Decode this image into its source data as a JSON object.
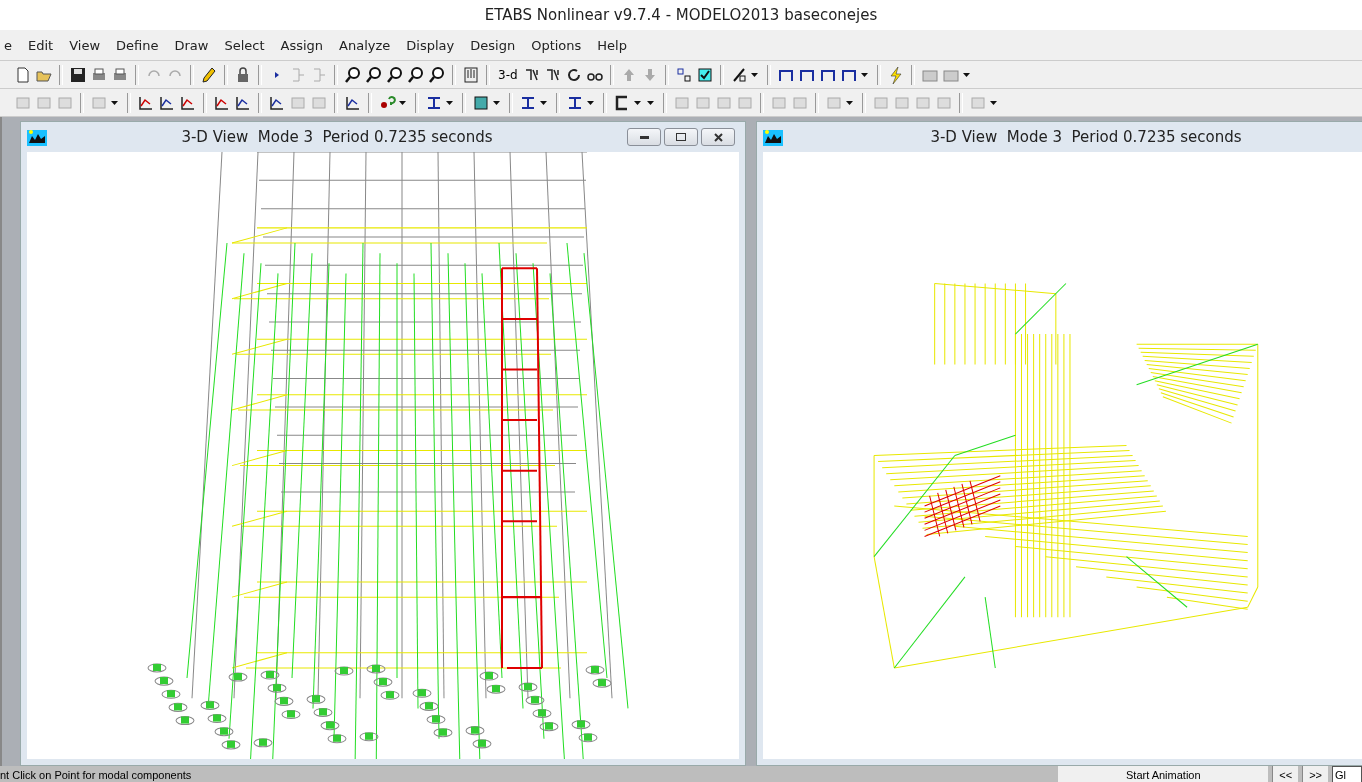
{
  "window": {
    "title": "ETABS Nonlinear v9.7.4 - MODELO2013 baseconejes"
  },
  "menu": [
    "e",
    "Edit",
    "View",
    "Define",
    "Draw",
    "Select",
    "Assign",
    "Analyze",
    "Display",
    "Design",
    "Options",
    "Help"
  ],
  "toolbar": {
    "view_3d_label": "3-d"
  },
  "views": [
    {
      "title": "3-D View  Mode 3  Period 0.7235 seconds",
      "kind": "tower",
      "controls": true
    },
    {
      "title": "3-D View  Mode 3  Period 0.7235 seconds",
      "kind": "plan",
      "controls": false
    }
  ],
  "status_bar": {
    "message": "nt Click on Point for modal components",
    "animation_button": "Start Animation",
    "prev_button": "<<",
    "next_button": ">>",
    "units_field": "Gl"
  }
}
